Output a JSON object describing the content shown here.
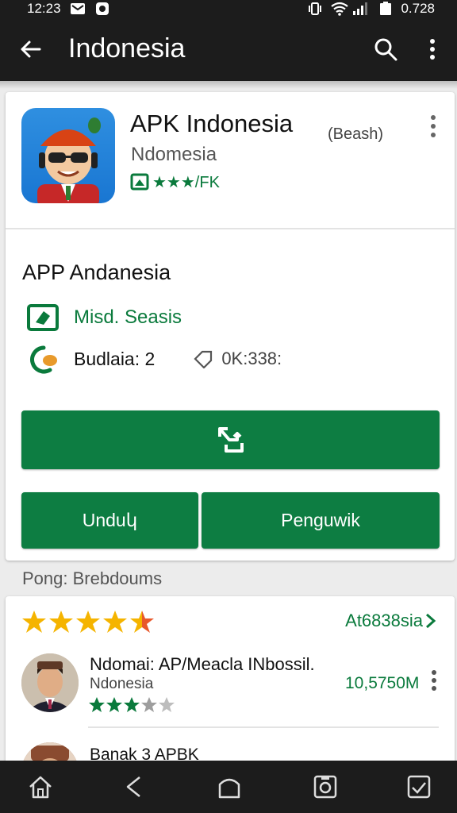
{
  "status_bar": {
    "time": "12:23",
    "right_time": "0.728"
  },
  "app_bar": {
    "title": "Indonesia"
  },
  "app": {
    "name": "APK Indonesia",
    "tag": "(Beash)",
    "developer": "Ndomesia",
    "rating_text": "★★★/FK"
  },
  "details": {
    "title": "APP Andanesia",
    "row1_label": "Misd. Seasis",
    "row2_label": "Budlaia: 2",
    "row2_value": "0K:338:"
  },
  "buttons": {
    "left_label": "Unduկ",
    "right_label": "Penguwik"
  },
  "section_label": "Pong: Brebdoums",
  "reviews": {
    "see_all": "At6838sia",
    "overall_rating": 4.5,
    "item1": {
      "title": "Ndomai: AP/Meacla INbossil.",
      "sub": "Ndonesia",
      "count": "10,5750M",
      "rating": 3.5
    },
    "item2": {
      "title": "Banak 3 APBK"
    }
  },
  "colors": {
    "accent": "#0d7d42",
    "bar": "#1c1c1c",
    "star": "#f5b400"
  }
}
